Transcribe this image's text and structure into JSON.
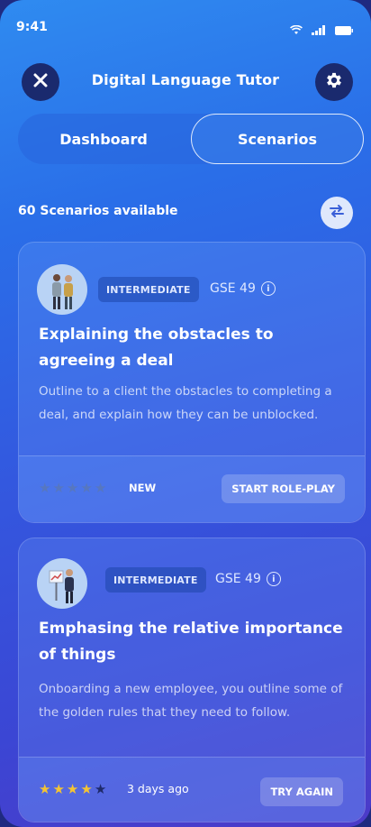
{
  "status_bar": {
    "time": "9:41"
  },
  "header": {
    "title": "Digital Language Tutor"
  },
  "tabs": [
    {
      "label": "Dashboard",
      "selected": false
    },
    {
      "label": "Scenarios",
      "selected": true
    }
  ],
  "scenario_count_text": "60 Scenarios available",
  "cards": [
    {
      "level": "INTERMEDIATE",
      "gse": "GSE 49",
      "title": "Explaining the obstacles to agreeing a deal",
      "description": "Outline to a client the obstacles to completing a deal, and explain how they can be unblocked.",
      "rating": 0,
      "rating_max": 5,
      "status": "NEW",
      "action_label": "START ROLE-PLAY",
      "icon": "two-people-icon"
    },
    {
      "level": "INTERMEDIATE",
      "gse": "GSE 49",
      "title": "Emphasing the relative importance of things",
      "description": "Onboarding a new employee, you outline some of the golden rules that they need to follow.",
      "rating": 4,
      "rating_max": 5,
      "status": "3 days ago",
      "action_label": "TRY AGAIN",
      "icon": "presenter-icon"
    }
  ],
  "colors": {
    "star_filled": "#f4c433",
    "accent_dark": "#1a2a6e"
  }
}
